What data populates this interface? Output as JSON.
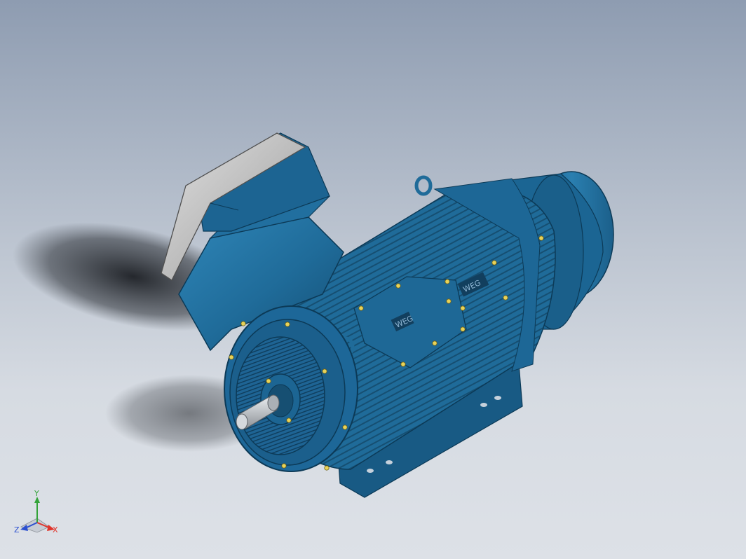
{
  "viewport": {
    "background_top": "#8e9cb1",
    "background_bottom": "#dde1e7"
  },
  "model": {
    "body_color": "#1f6b99",
    "cover_color": "#bdbdbd",
    "shaft_color": "#c8ccd0",
    "bolt_color": "#e8d35a",
    "logo_text": "WEG"
  },
  "triad": {
    "x_label": "X",
    "y_label": "Y",
    "z_label": "Z",
    "x_color": "#e0342b",
    "y_color": "#34a33a",
    "z_color": "#2b4fd0"
  }
}
